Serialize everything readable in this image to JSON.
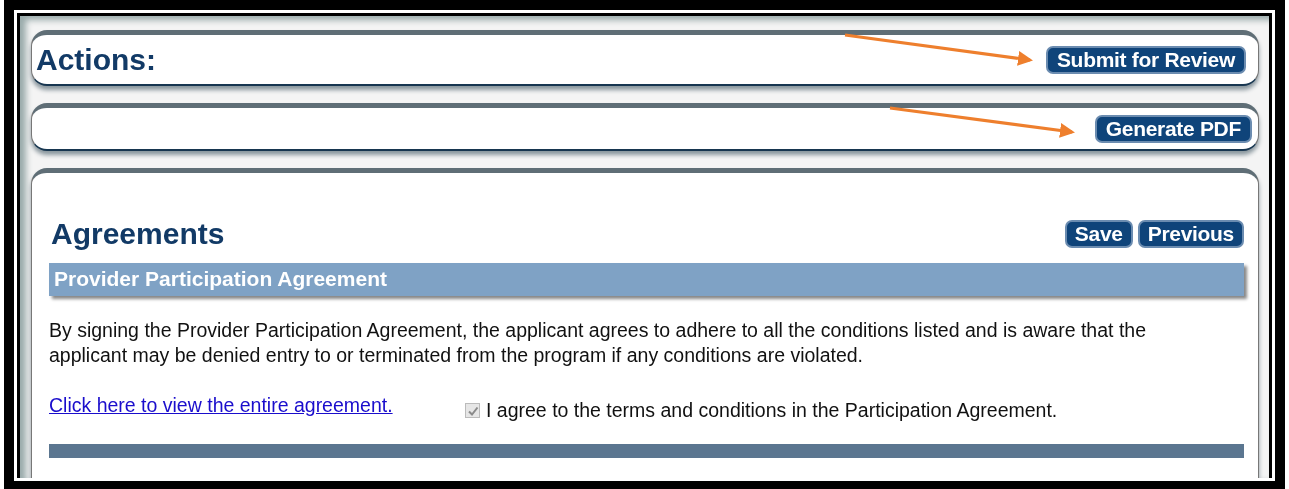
{
  "actions_panel": {
    "title": "Actions:",
    "button": "Submit for Review"
  },
  "pdf_panel": {
    "button": "Generate PDF"
  },
  "agreements": {
    "title": "Agreements",
    "buttons": [
      "Save",
      "Previous"
    ],
    "section": {
      "title": "Provider Participation Agreement",
      "text": "By signing the Provider Participation Agreement, the applicant agrees to adhere to all the conditions listed and is aware that the applicant may be denied entry to or terminated from the program if any conditions are violated.",
      "link": "Click here to view the entire agreement.",
      "checkbox": {
        "label": "I agree to the terms and conditions in the Participation Agreement.",
        "checked": true,
        "disabled": true
      }
    }
  }
}
